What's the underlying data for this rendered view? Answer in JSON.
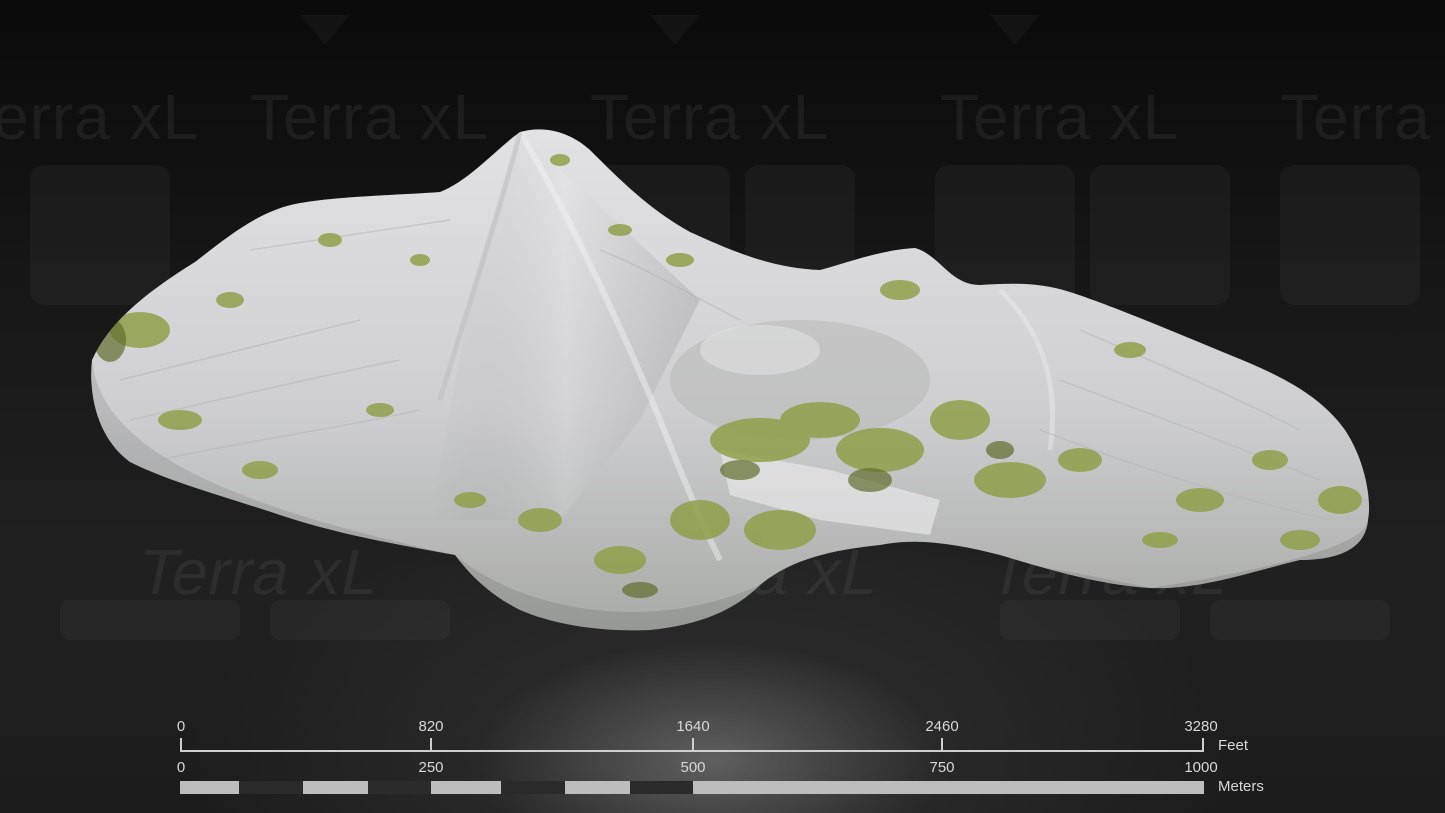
{
  "watermark": {
    "text": "Terra xL"
  },
  "scale_bar": {
    "feet": {
      "unit": "Feet",
      "ticks": [
        "0",
        "820",
        "1640",
        "2460",
        "3280"
      ]
    },
    "meters": {
      "unit": "Meters",
      "ticks": [
        "0",
        "250",
        "500",
        "750",
        "1000"
      ]
    }
  },
  "colors": {
    "rock": "#d6d6d8",
    "vegetation": "#8fa04a",
    "scale": "#cfcfcf",
    "meter_dark": "#2a2a2a",
    "meter_light": "#bdbdbd"
  }
}
